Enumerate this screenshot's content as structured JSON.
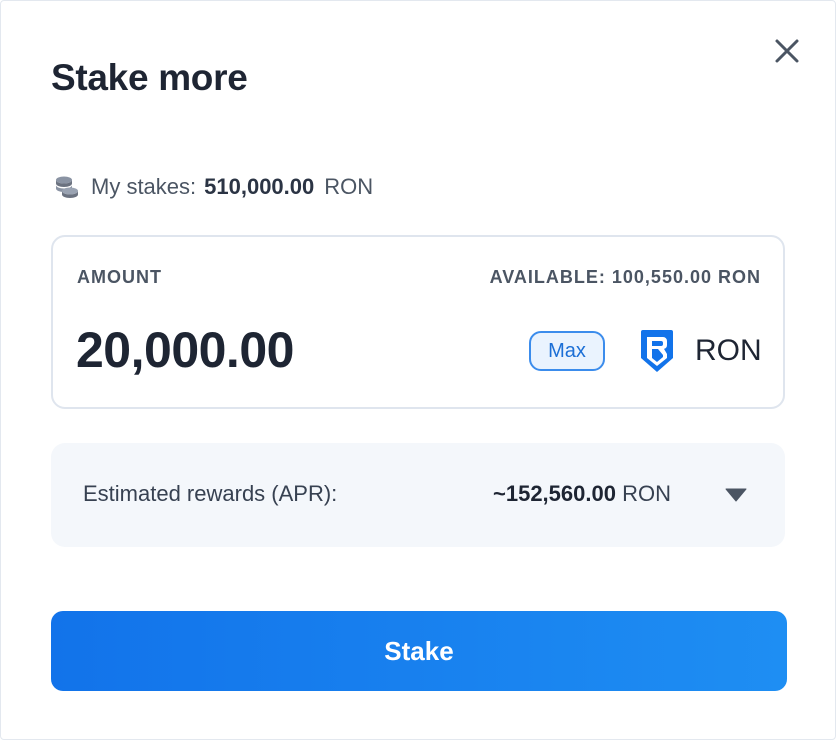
{
  "modal": {
    "title": "Stake more",
    "close_icon": "close-icon"
  },
  "stakes": {
    "label": "My stakes:",
    "value": "510,000.00",
    "unit": "RON",
    "icon": "coins-icon"
  },
  "amount": {
    "label": "AMOUNT",
    "available": "AVAILABLE: 100,550.00 RON",
    "value": "20,000.00",
    "max_label": "Max",
    "token_icon": "ronin-logo-icon",
    "token": "RON"
  },
  "rewards": {
    "label": "Estimated rewards (APR):",
    "value": "~152,560.00",
    "unit": "RON",
    "toggle_icon": "caret-down-icon"
  },
  "actions": {
    "stake_label": "Stake"
  },
  "colors": {
    "accent": "#1273ea",
    "accent_light": "#1e8ef3",
    "panel_bg": "#f4f7fb",
    "border": "#dfe5ee",
    "text_dark": "#1e2533"
  }
}
